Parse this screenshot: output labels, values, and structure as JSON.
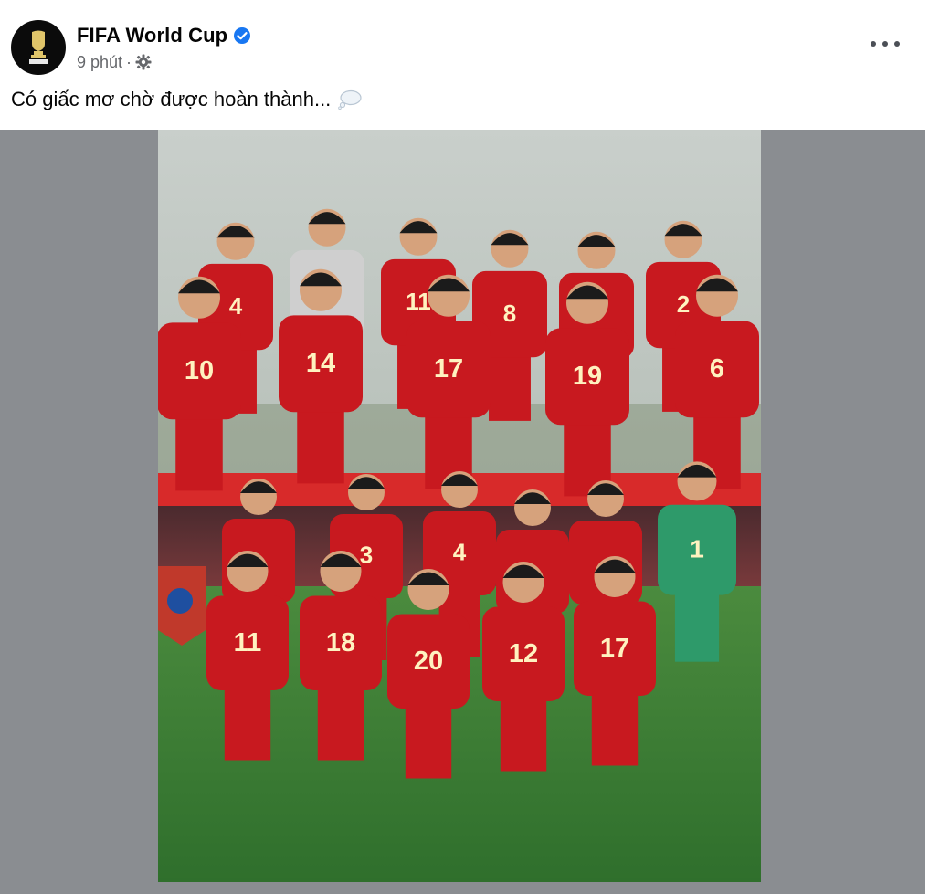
{
  "post": {
    "author": "FIFA World Cup",
    "time": "9 phút",
    "separator": "·",
    "privacy_icon": "gear-icon",
    "verified_icon": "verified-badge-icon",
    "text": "Có giấc mơ chờ được hoàn thành...",
    "emoji_icon": "thought-bubble-icon",
    "more_icon": "more-options-icon"
  },
  "photo": {
    "top_numbers": [
      "4",
      "11",
      "8",
      "2",
      "10",
      "14",
      "17",
      "19",
      "6"
    ],
    "bottom_numbers": [
      "3",
      "4",
      "1",
      "11",
      "18",
      "20",
      "12",
      "17"
    ],
    "colors": {
      "jersey": "#c8191f",
      "keeper": "#2e9a6a",
      "grass": "#3d8a3a",
      "sky": "#cfd6d2"
    }
  }
}
